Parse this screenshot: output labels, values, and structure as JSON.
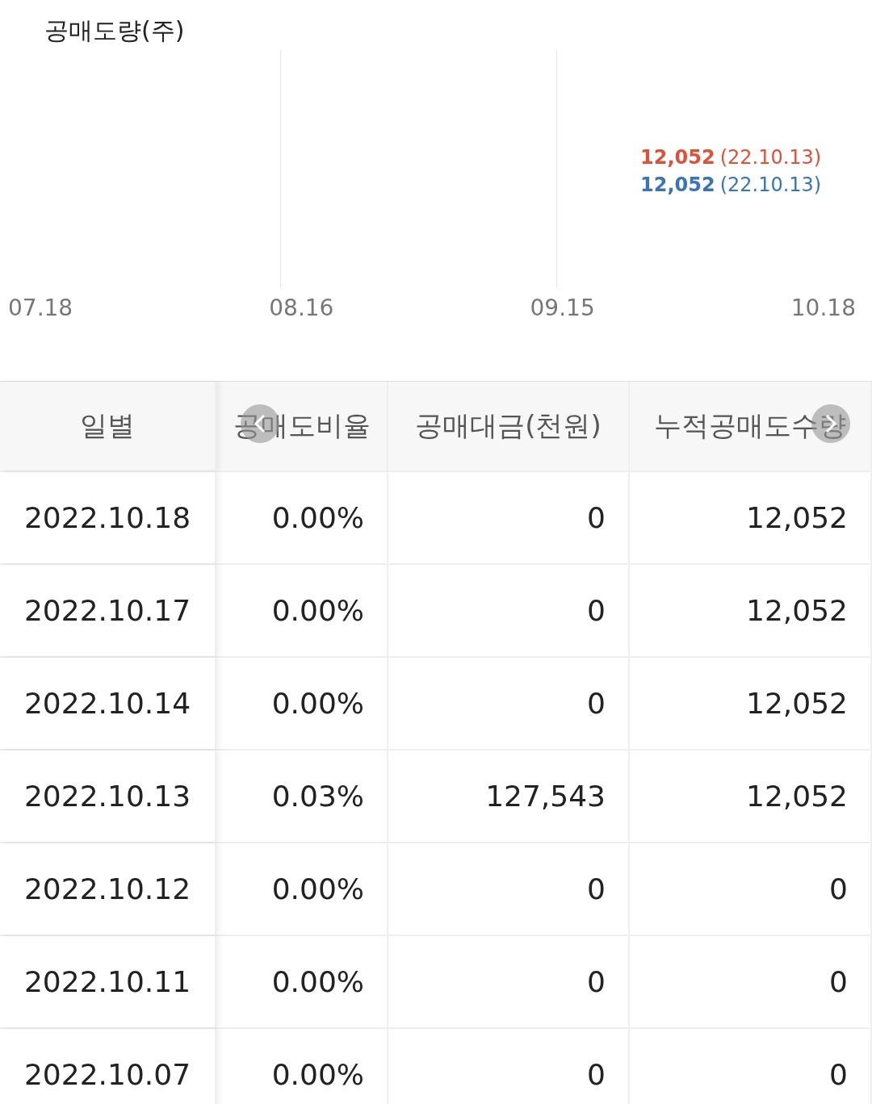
{
  "chart": {
    "title": "공매도량(주)",
    "legend": [
      {
        "value": "12,052",
        "date": "(22.10.13)",
        "color": "#d9533b"
      },
      {
        "value": "12,052",
        "date": "(22.10.13)",
        "color": "#3a74b3"
      }
    ],
    "x_labels": [
      "07.18",
      "08.16",
      "09.15",
      "10.18"
    ]
  },
  "table": {
    "columns": [
      "일별",
      "공매도비율",
      "공매대금(천원)",
      "누적공매도수량"
    ],
    "scroll_buttons": [
      {
        "kind": "left"
      },
      {
        "kind": "right"
      }
    ],
    "rows": [
      [
        "2022.10.18",
        "0.00%",
        "0",
        "12,052"
      ],
      [
        "2022.10.17",
        "0.00%",
        "0",
        "12,052"
      ],
      [
        "2022.10.14",
        "0.00%",
        "0",
        "12,052"
      ],
      [
        "2022.10.13",
        "0.03%",
        "127,543",
        "12,052"
      ],
      [
        "2022.10.12",
        "0.00%",
        "0",
        "0"
      ],
      [
        "2022.10.11",
        "0.00%",
        "0",
        "0"
      ],
      [
        "2022.10.07",
        "0.00%",
        "0",
        "0"
      ]
    ]
  }
}
